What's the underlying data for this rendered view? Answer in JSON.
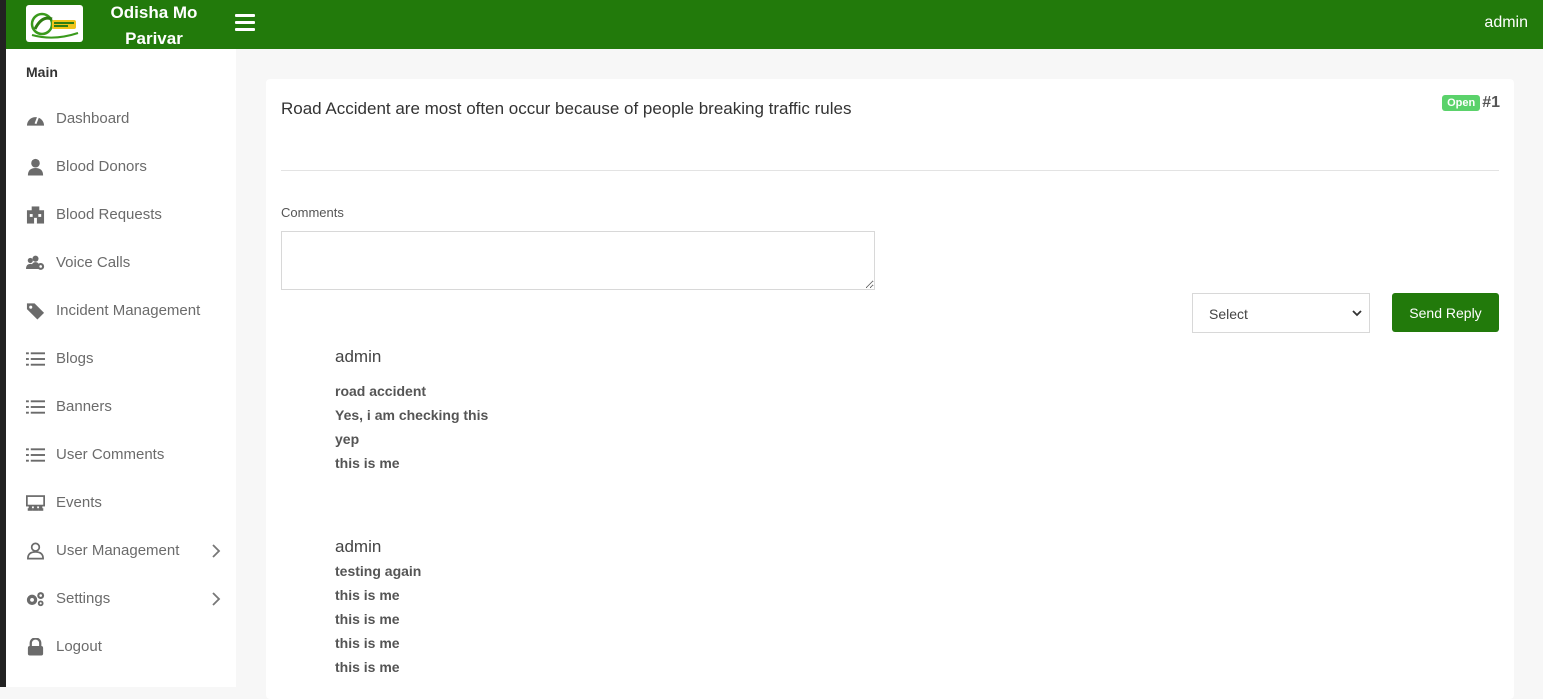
{
  "app": {
    "title_line1": "Odisha Mo",
    "title_line2": "Parivar",
    "user": "admin"
  },
  "sidebar": {
    "heading": "Main",
    "items": [
      {
        "label": "Dashboard",
        "icon": "gauge-icon"
      },
      {
        "label": "Blood Donors",
        "icon": "user-icon"
      },
      {
        "label": "Blood Requests",
        "icon": "hospital-icon"
      },
      {
        "label": "Voice Calls",
        "icon": "users-cog-icon"
      },
      {
        "label": "Incident Management",
        "icon": "tag-icon"
      },
      {
        "label": "Blogs",
        "icon": "list-icon"
      },
      {
        "label": "Banners",
        "icon": "list-icon"
      },
      {
        "label": "User Comments",
        "icon": "list-icon"
      },
      {
        "label": "Events",
        "icon": "chalkboard-icon"
      },
      {
        "label": "User Management",
        "icon": "user-outline-icon",
        "has_submenu": true
      },
      {
        "label": "Settings",
        "icon": "gears-icon",
        "has_submenu": true
      },
      {
        "label": "Logout",
        "icon": "lock-icon"
      }
    ]
  },
  "ticket": {
    "title": "Road Accident are most often occur because of people breaking traffic rules",
    "status": "Open",
    "number": "#1"
  },
  "form": {
    "comments_label": "Comments",
    "comments_value": "",
    "select_value": "Select",
    "send_label": "Send Reply"
  },
  "replies": [
    {
      "author": "admin",
      "lines": [
        "road accident",
        "Yes, i am checking this",
        "yep",
        "this is me"
      ]
    },
    {
      "author": "admin",
      "lines": [
        "testing again",
        "this is me",
        "this is me",
        "this is me",
        "this is me"
      ]
    }
  ],
  "colors": {
    "primary": "#227a0b",
    "badge": "#5bd26b"
  }
}
